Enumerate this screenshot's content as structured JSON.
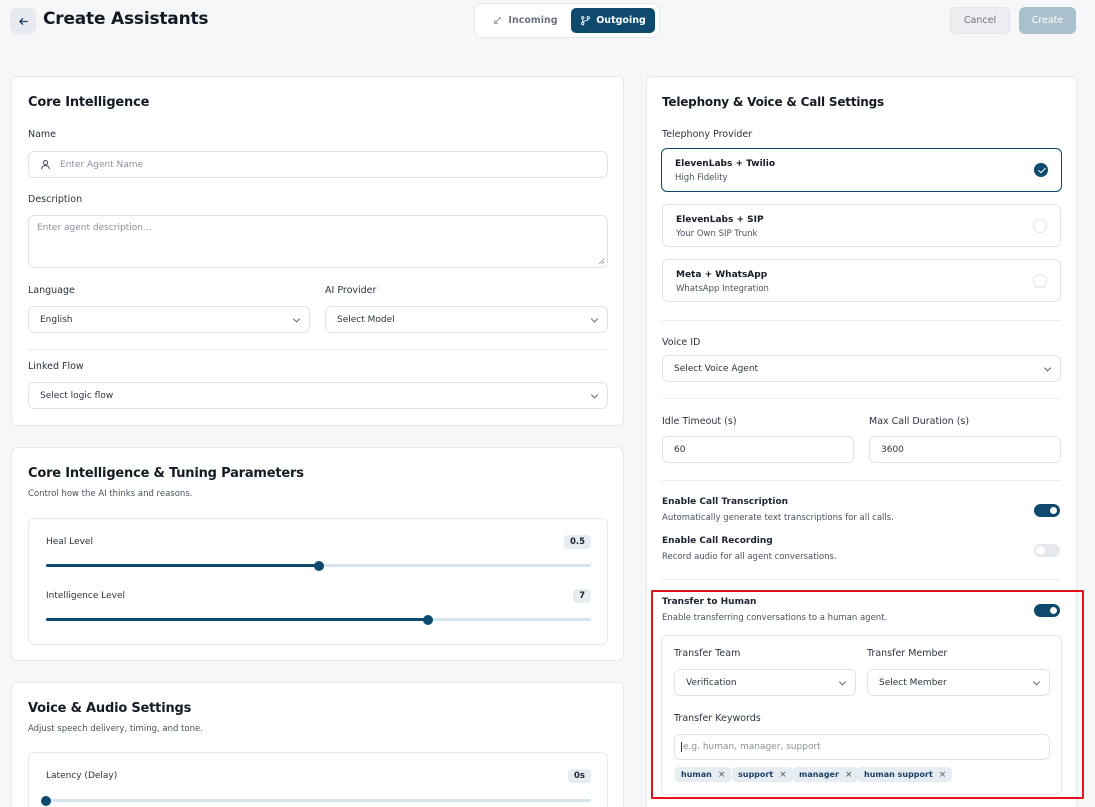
{
  "header": {
    "back_icon": "arrow-left-icon",
    "title": "Create Assistants",
    "mode_tabs": [
      {
        "label": "Incoming",
        "icon": "incoming-call-icon",
        "active": false
      },
      {
        "label": "Outgoing",
        "icon": "outgoing-branch-icon",
        "active": true
      }
    ],
    "cancel_label": "Cancel",
    "create_label": "Create"
  },
  "core": {
    "title": "Core Intelligence",
    "name_label": "Name",
    "name_placeholder": "Enter Agent Name",
    "description_label": "Description",
    "description_placeholder": "Enter agent description...",
    "language_label": "Language",
    "language_value": "English",
    "provider_label": "AI Provider",
    "provider_value": "Select Model",
    "flow_label": "Linked Flow",
    "flow_value": "Select logic flow"
  },
  "tuning": {
    "title": "Core Intelligence & Tuning Parameters",
    "subtitle": "Control how the AI thinks and reasons.",
    "heal_label": "Heal Level",
    "heal_value": "0.5",
    "heal_fraction": 0.5,
    "intel_label": "Intelligence Level",
    "intel_value": "7",
    "intel_fraction": 0.7
  },
  "voice_audio": {
    "title": "Voice & Audio Settings",
    "subtitle": "Adjust speech delivery, timing, and tone.",
    "latency_label": "Latency (Delay)",
    "latency_value": "0s",
    "latency_fraction": 0
  },
  "telephony": {
    "title": "Telephony & Voice & Call Settings",
    "provider_label": "Telephony Provider",
    "providers": [
      {
        "name": "ElevenLabs + Twilio",
        "desc": "High Fidelity",
        "selected": true
      },
      {
        "name": "ElevenLabs + SIP",
        "desc": "Your Own SIP Trunk",
        "selected": false
      },
      {
        "name": "Meta + WhatsApp",
        "desc": "WhatsApp Integration",
        "selected": false
      }
    ],
    "voice_label": "Voice ID",
    "voice_value": "Select Voice Agent",
    "idle_label": "Idle Timeout (s)",
    "idle_value": "60",
    "max_label": "Max Call Duration (s)",
    "max_value": "3600",
    "transcription_title": "Enable Call Transcription",
    "transcription_desc": "Automatically generate text transcriptions for all calls.",
    "transcription_on": true,
    "recording_title": "Enable Call Recording",
    "recording_desc": "Record audio for all agent conversations.",
    "recording_on": false,
    "transfer_title": "Transfer to Human",
    "transfer_desc": "Enable transferring conversations to a human agent.",
    "transfer_on": true,
    "team_label": "Transfer Team",
    "team_value": "Verification",
    "member_label": "Transfer Member",
    "member_value": "Select Member",
    "keywords_label": "Transfer Keywords",
    "keywords_placeholder": "e.g. human, manager, support",
    "keywords": [
      "human",
      "support",
      "manager",
      "human support"
    ],
    "chip_remove": "×"
  },
  "colors": {
    "primary": "#0d4a6e",
    "highlight": "#e0121b"
  }
}
